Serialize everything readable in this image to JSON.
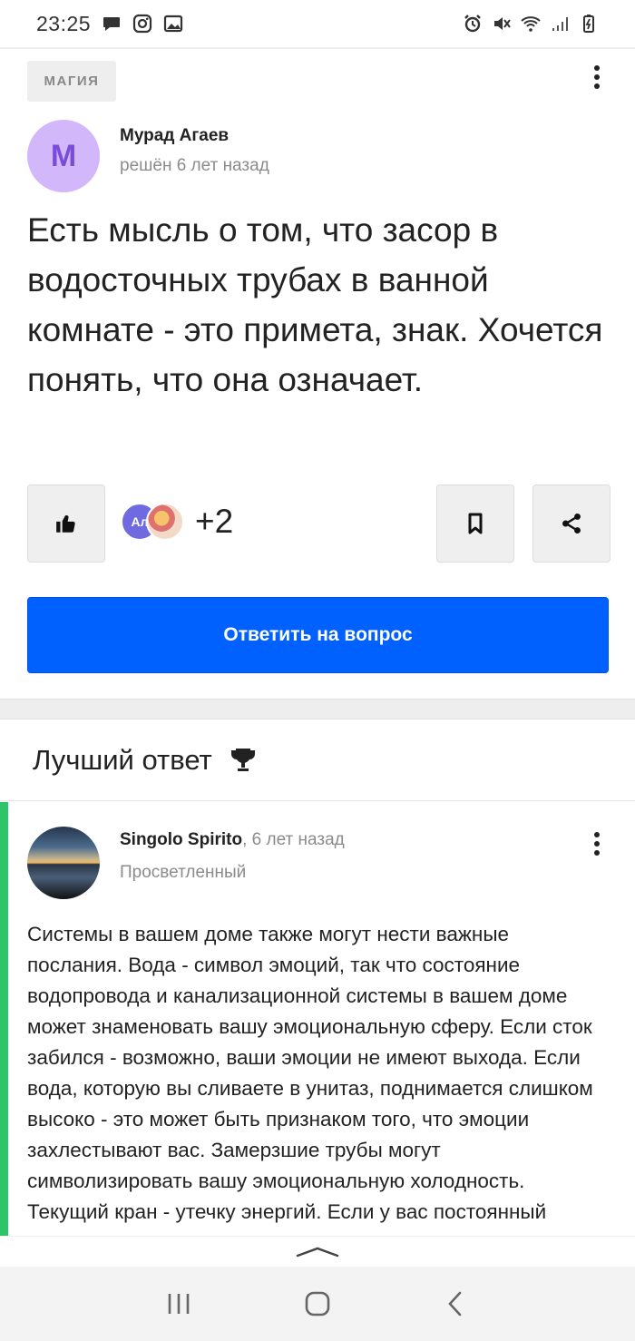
{
  "status_bar": {
    "time": "23:25",
    "left_icons": [
      "chat-bubble-icon",
      "instagram-icon",
      "gallery-icon"
    ],
    "right_icons": [
      "alarm-icon",
      "mute-vibrate-icon",
      "wifi-icon",
      "signal-icon",
      "battery-icon"
    ]
  },
  "question": {
    "tag": "МАГИЯ",
    "author": "Мурад Агаев",
    "avatar_letter": "M",
    "meta": "решён 6 лет назад",
    "text": "Есть мысль о том, что засор в водосточных трубах в ванной комнате - это примета, знак. Хочется понять, что она означает.",
    "voters_initial": "Ал",
    "votes_extra": "+2",
    "answer_button": "Ответить на вопрос"
  },
  "best_answer": {
    "title": "Лучший ответ",
    "author": "Singolo Spirito",
    "time": ", 6 лет назад",
    "rank": "Просветленный",
    "text": "Системы в вашем доме также могут нести важные послания. Вода - символ эмоций, так что состояние водопровода и канализационной системы в вашем доме может знаменовать вашу эмоциональную сферу. Если сток забился - возможно, ваши эмоции не имеют выхода. Если вода, которую вы сливаете в унитаз, поднимается слишком высоко - это может быть признаком того, что эмоции захлестывают вас. Замерзшие трубы могут символизировать вашу эмоциональную холодность. Текущий кран - утечку энергий. Если у вас постоянный засор..."
  },
  "colors": {
    "accent": "#0061ff",
    "best_answer_bar": "#2ec46a",
    "avatar_bg": "#d2b8fb",
    "avatar_letter": "#7a4dd8"
  }
}
